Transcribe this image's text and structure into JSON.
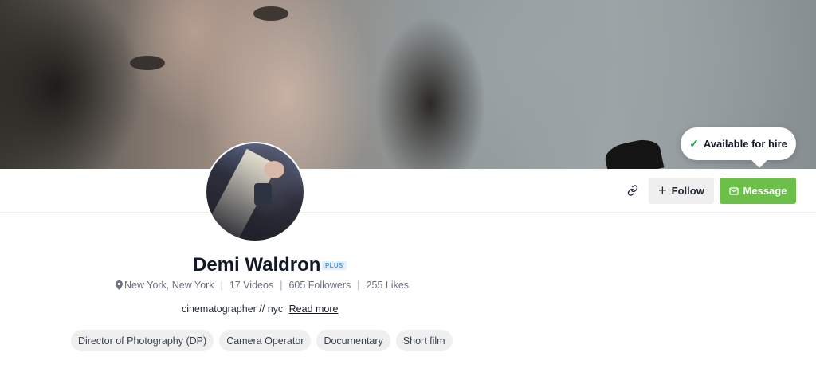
{
  "cover": {
    "icon": "cover-photo"
  },
  "hire_badge": {
    "label": "Available for hire",
    "icon": "check-icon",
    "accent": "#16a34a"
  },
  "actions": {
    "link_icon": "link-icon",
    "follow_label": "Follow",
    "follow_icon": "plus-icon",
    "message_label": "Message",
    "message_icon": "envelope-icon",
    "message_color": "#6cc04a"
  },
  "profile": {
    "name": "Demi Waldron",
    "badge": "PLUS",
    "location": "New York, New York",
    "videos": "17 Videos",
    "followers": "605 Followers",
    "likes": "255 Likes",
    "bio": "cinematographer // nyc",
    "read_more": "Read more"
  },
  "tags": [
    "Director of Photography (DP)",
    "Camera Operator",
    "Documentary",
    "Short film"
  ]
}
